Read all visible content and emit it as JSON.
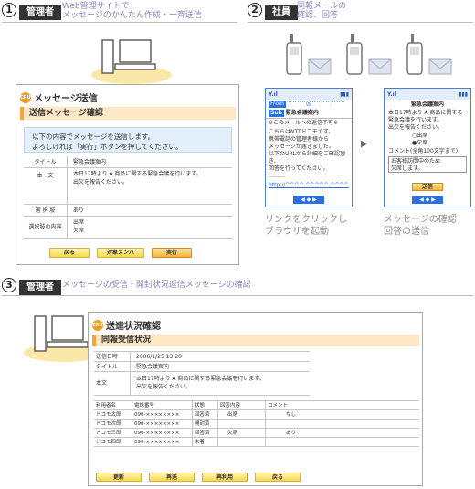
{
  "section1": {
    "number": "1",
    "tag": "管理者",
    "caption_line1": "Web管理サイトで",
    "caption_line2": "メッセージのかんたん作成・一斉送信",
    "screen": {
      "icon_text": "CRUSH",
      "title": "メッセージ送信",
      "subtitle": "送信メッセージ確認",
      "notice_line1": "以下の内容でメッセージを送信します。",
      "notice_line2": "よろしければ「実行」ボタンを押してください。",
      "rows": [
        {
          "label": "タイトル",
          "value": "緊急会議案内"
        },
        {
          "label": "本　文",
          "value": "本日17時より A 商品に関する緊急会議を行います。\n出欠を報告ください。"
        },
        {
          "label": "選 択 肢",
          "value": "あり"
        },
        {
          "label": "選択肢の内容",
          "value": "出席\n欠席"
        }
      ],
      "buttons": {
        "back": "戻る",
        "members": "対象メンバ",
        "run": "実行"
      }
    }
  },
  "section2": {
    "number": "2",
    "tag": "社員",
    "caption_line1": "同報メールの",
    "caption_line2": "確認、回答",
    "phone1": {
      "status": "Y.ıl",
      "from_label": "From",
      "from_value": "^^^^@^^^^.^^^",
      "subject_label": "Sub",
      "subject_value": "緊急会議案内",
      "warning": "※このメールへの返信不可※",
      "body_lines": [
        "こちらはNTTドコモです。",
        "携帯電話の管理者様から",
        "メッセージが届きました。",
        "以下のURLから詳細をご確認頂き、",
        "回答を行ってください。",
        "………"
      ],
      "link": "http://^^^^.^^^^^.^^^^",
      "nav": "◀ ◆ ▶"
    },
    "phone2": {
      "status": "Y.ıl",
      "title": "緊急会議案内",
      "body_lines": [
        "本日17時より A 商品に関する",
        "緊急会議を行います。",
        "出欠を報告ください。"
      ],
      "options": [
        "○出席",
        "●欠席"
      ],
      "comment_label": "コメント(全角100文字まで)",
      "comment_value": "お客様訪問中のため\n欠席します。",
      "send": "送信",
      "nav": "◀ ◆ ▶"
    },
    "caption_left_line1": "リンクをクリックし",
    "caption_left_line2": "ブラウザを起動",
    "caption_right_line1": "メッセージの確認",
    "caption_right_line2": "回答の送信"
  },
  "section3": {
    "number": "3",
    "tag": "管理者",
    "caption": "メッセージの受信・開封状況返信メッセージの確認",
    "screen": {
      "icon_text": "CRUSH",
      "title": "送達状況確認",
      "subtitle": "同報受信状況",
      "info": [
        {
          "label": "送信日時",
          "value": "2006/1/25 13:20"
        },
        {
          "label": "タイトル",
          "value": "緊急会議案内"
        },
        {
          "label": "本文",
          "value": "本日17時より A 商品に関する緊急会議を行います。\n出欠を報告ください。"
        }
      ],
      "headers": [
        "利用者名",
        "電話番号",
        "状態",
        "回答内容",
        "コメント"
      ],
      "rows": [
        [
          "ドコモ太郎",
          "090-××××××××",
          "回答済",
          "出席",
          "なし"
        ],
        [
          "ドコモ次郎",
          "090-××××××××",
          "開封済",
          "",
          ""
        ],
        [
          "ドコモ三郎",
          "090-××××××××",
          "回答済",
          "欠席",
          "あり"
        ],
        [
          "ドコモ四郎",
          "090-××××××××",
          "未着",
          "",
          ""
        ]
      ],
      "buttons": [
        "更新",
        "再送",
        "再利用",
        "戻る"
      ]
    }
  }
}
